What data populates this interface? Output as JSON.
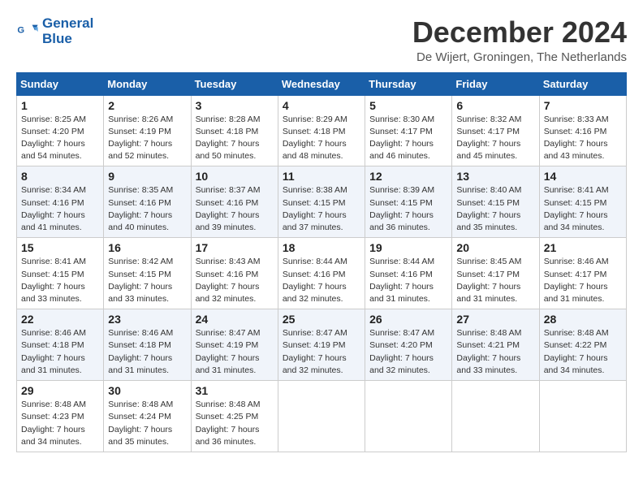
{
  "header": {
    "logo_line1": "General",
    "logo_line2": "Blue",
    "month": "December 2024",
    "location": "De Wijert, Groningen, The Netherlands"
  },
  "weekdays": [
    "Sunday",
    "Monday",
    "Tuesday",
    "Wednesday",
    "Thursday",
    "Friday",
    "Saturday"
  ],
  "weeks": [
    [
      {
        "day": "1",
        "info": "Sunrise: 8:25 AM\nSunset: 4:20 PM\nDaylight: 7 hours\nand 54 minutes."
      },
      {
        "day": "2",
        "info": "Sunrise: 8:26 AM\nSunset: 4:19 PM\nDaylight: 7 hours\nand 52 minutes."
      },
      {
        "day": "3",
        "info": "Sunrise: 8:28 AM\nSunset: 4:18 PM\nDaylight: 7 hours\nand 50 minutes."
      },
      {
        "day": "4",
        "info": "Sunrise: 8:29 AM\nSunset: 4:18 PM\nDaylight: 7 hours\nand 48 minutes."
      },
      {
        "day": "5",
        "info": "Sunrise: 8:30 AM\nSunset: 4:17 PM\nDaylight: 7 hours\nand 46 minutes."
      },
      {
        "day": "6",
        "info": "Sunrise: 8:32 AM\nSunset: 4:17 PM\nDaylight: 7 hours\nand 45 minutes."
      },
      {
        "day": "7",
        "info": "Sunrise: 8:33 AM\nSunset: 4:16 PM\nDaylight: 7 hours\nand 43 minutes."
      }
    ],
    [
      {
        "day": "8",
        "info": "Sunrise: 8:34 AM\nSunset: 4:16 PM\nDaylight: 7 hours\nand 41 minutes."
      },
      {
        "day": "9",
        "info": "Sunrise: 8:35 AM\nSunset: 4:16 PM\nDaylight: 7 hours\nand 40 minutes."
      },
      {
        "day": "10",
        "info": "Sunrise: 8:37 AM\nSunset: 4:16 PM\nDaylight: 7 hours\nand 39 minutes."
      },
      {
        "day": "11",
        "info": "Sunrise: 8:38 AM\nSunset: 4:15 PM\nDaylight: 7 hours\nand 37 minutes."
      },
      {
        "day": "12",
        "info": "Sunrise: 8:39 AM\nSunset: 4:15 PM\nDaylight: 7 hours\nand 36 minutes."
      },
      {
        "day": "13",
        "info": "Sunrise: 8:40 AM\nSunset: 4:15 PM\nDaylight: 7 hours\nand 35 minutes."
      },
      {
        "day": "14",
        "info": "Sunrise: 8:41 AM\nSunset: 4:15 PM\nDaylight: 7 hours\nand 34 minutes."
      }
    ],
    [
      {
        "day": "15",
        "info": "Sunrise: 8:41 AM\nSunset: 4:15 PM\nDaylight: 7 hours\nand 33 minutes."
      },
      {
        "day": "16",
        "info": "Sunrise: 8:42 AM\nSunset: 4:15 PM\nDaylight: 7 hours\nand 33 minutes."
      },
      {
        "day": "17",
        "info": "Sunrise: 8:43 AM\nSunset: 4:16 PM\nDaylight: 7 hours\nand 32 minutes."
      },
      {
        "day": "18",
        "info": "Sunrise: 8:44 AM\nSunset: 4:16 PM\nDaylight: 7 hours\nand 32 minutes."
      },
      {
        "day": "19",
        "info": "Sunrise: 8:44 AM\nSunset: 4:16 PM\nDaylight: 7 hours\nand 31 minutes."
      },
      {
        "day": "20",
        "info": "Sunrise: 8:45 AM\nSunset: 4:17 PM\nDaylight: 7 hours\nand 31 minutes."
      },
      {
        "day": "21",
        "info": "Sunrise: 8:46 AM\nSunset: 4:17 PM\nDaylight: 7 hours\nand 31 minutes."
      }
    ],
    [
      {
        "day": "22",
        "info": "Sunrise: 8:46 AM\nSunset: 4:18 PM\nDaylight: 7 hours\nand 31 minutes."
      },
      {
        "day": "23",
        "info": "Sunrise: 8:46 AM\nSunset: 4:18 PM\nDaylight: 7 hours\nand 31 minutes."
      },
      {
        "day": "24",
        "info": "Sunrise: 8:47 AM\nSunset: 4:19 PM\nDaylight: 7 hours\nand 31 minutes."
      },
      {
        "day": "25",
        "info": "Sunrise: 8:47 AM\nSunset: 4:19 PM\nDaylight: 7 hours\nand 32 minutes."
      },
      {
        "day": "26",
        "info": "Sunrise: 8:47 AM\nSunset: 4:20 PM\nDaylight: 7 hours\nand 32 minutes."
      },
      {
        "day": "27",
        "info": "Sunrise: 8:48 AM\nSunset: 4:21 PM\nDaylight: 7 hours\nand 33 minutes."
      },
      {
        "day": "28",
        "info": "Sunrise: 8:48 AM\nSunset: 4:22 PM\nDaylight: 7 hours\nand 34 minutes."
      }
    ],
    [
      {
        "day": "29",
        "info": "Sunrise: 8:48 AM\nSunset: 4:23 PM\nDaylight: 7 hours\nand 34 minutes."
      },
      {
        "day": "30",
        "info": "Sunrise: 8:48 AM\nSunset: 4:24 PM\nDaylight: 7 hours\nand 35 minutes."
      },
      {
        "day": "31",
        "info": "Sunrise: 8:48 AM\nSunset: 4:25 PM\nDaylight: 7 hours\nand 36 minutes."
      },
      null,
      null,
      null,
      null
    ]
  ]
}
